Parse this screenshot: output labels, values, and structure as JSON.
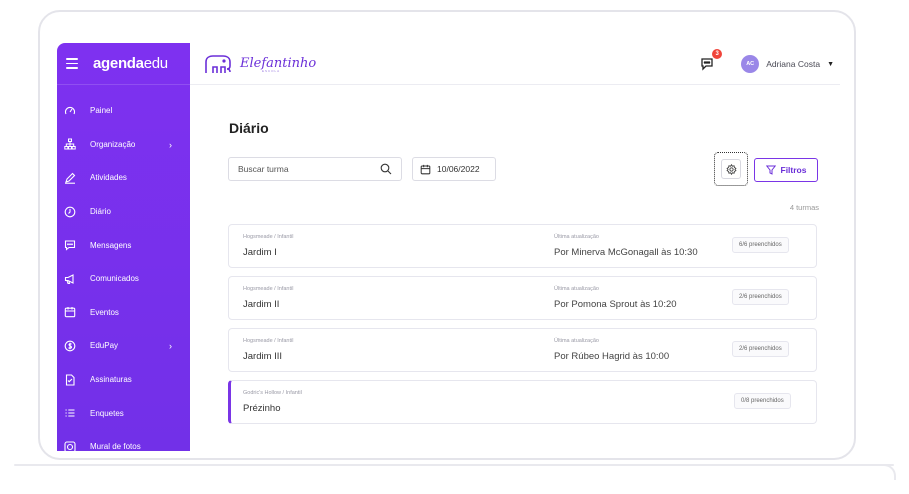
{
  "sidebar": {
    "brand_bold": "agenda",
    "brand_light": "edu",
    "items": [
      {
        "label": "Painel",
        "icon": "speedometer-icon"
      },
      {
        "label": "Organização",
        "icon": "org-chart-icon",
        "has_submenu": true
      },
      {
        "label": "Atividades",
        "icon": "pencil-icon"
      },
      {
        "label": "Diário",
        "icon": "clock-icon"
      },
      {
        "label": "Mensagens",
        "icon": "message-icon"
      },
      {
        "label": "Comunicados",
        "icon": "megaphone-icon"
      },
      {
        "label": "Eventos",
        "icon": "calendar-icon"
      },
      {
        "label": "EduPay",
        "icon": "dollar-icon",
        "has_submenu": true
      },
      {
        "label": "Assinaturas",
        "icon": "document-icon"
      },
      {
        "label": "Enquetes",
        "icon": "list-icon"
      },
      {
        "label": "Mural de fotos",
        "icon": "camera-icon"
      }
    ]
  },
  "header": {
    "logo_text": "Elefantinho",
    "logo_sub": "ESCOLA",
    "notification_count": "3",
    "avatar_initials": "AC",
    "user_name": "Adriana Costa"
  },
  "main": {
    "title": "Diário",
    "search_placeholder": "Buscar turma",
    "date": "10/06/2022",
    "filter_label": "Filtros",
    "count_label": "4 turmas",
    "rows": [
      {
        "category": "Hogsmeade / Infantil",
        "name": "Jardim I",
        "updated_label": "Última atualização",
        "updated_by": "Por Minerva McGonagall às 10:30",
        "badge": "6/6 preenchidos"
      },
      {
        "category": "Hogsmeade / Infantil",
        "name": "Jardim II",
        "updated_label": "Última atualização",
        "updated_by": "Por Pomona Sprout às 10:20",
        "badge": "2/6 preenchidos"
      },
      {
        "category": "Hogsmeade / Infantil",
        "name": "Jardim III",
        "updated_label": "Última atualização",
        "updated_by": "Por Rúbeo Hagrid às 10:00",
        "badge": "2/6 preenchidos"
      },
      {
        "category": "Godric's Hollow / Infantil",
        "name": "Prézinho",
        "updated_label": "",
        "updated_by": "",
        "badge": "0/8 preenchidos"
      }
    ]
  },
  "colors": {
    "accent": "#7a35e6",
    "sidebar_bg": "#7b30ee",
    "notification": "#f0443a"
  }
}
